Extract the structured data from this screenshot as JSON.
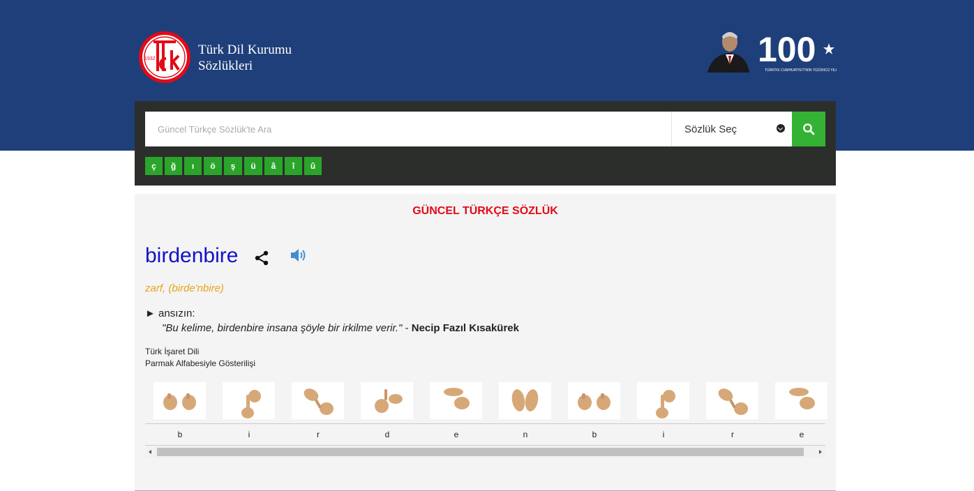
{
  "header": {
    "brand_line1": "Türk Dil Kurumu",
    "brand_line2": "Sözlükleri",
    "logo_year": "1932",
    "logo_letters": "TDK",
    "centennial_number": "100",
    "centennial_caption": "TÜRKİYE CUMHURİYETİ'NİN YÜZÜNCÜ YILI"
  },
  "search": {
    "placeholder": "Güncel Türkçe Sözlük'te Ara",
    "dictionary_select_label": "Sözlük Seç",
    "special_letters": [
      "ç",
      "ğ",
      "ı",
      "ö",
      "ş",
      "ü",
      "â",
      "î",
      "û"
    ]
  },
  "entry": {
    "dictionary_title": "GÜNCEL TÜRKÇE SÖZLÜK",
    "word": "birdenbire",
    "pos_and_pronunciation": "zarf, (birde'nbire)",
    "meaning_marker": "►",
    "meaning": "ansızın:",
    "example_quote": "\"Bu kelime, birdenbire insana şöyle bir irkilme verir.\"",
    "example_separator": "-",
    "example_author": "Necip Fazıl Kısakürek"
  },
  "sign_language": {
    "title_line1": "Türk İşaret Dili",
    "title_line2": "Parmak Alfabesiyle Gösterilişi",
    "letters": [
      "b",
      "i",
      "r",
      "d",
      "e",
      "n",
      "b",
      "i",
      "r",
      "e"
    ]
  },
  "colors": {
    "header_bg": "#1f3f7a",
    "panel_bg": "#2c2e2b",
    "accent_green": "#34b233",
    "title_red": "#e30a17",
    "word_blue": "#1111cc",
    "pos_orange": "#e8a31b"
  }
}
